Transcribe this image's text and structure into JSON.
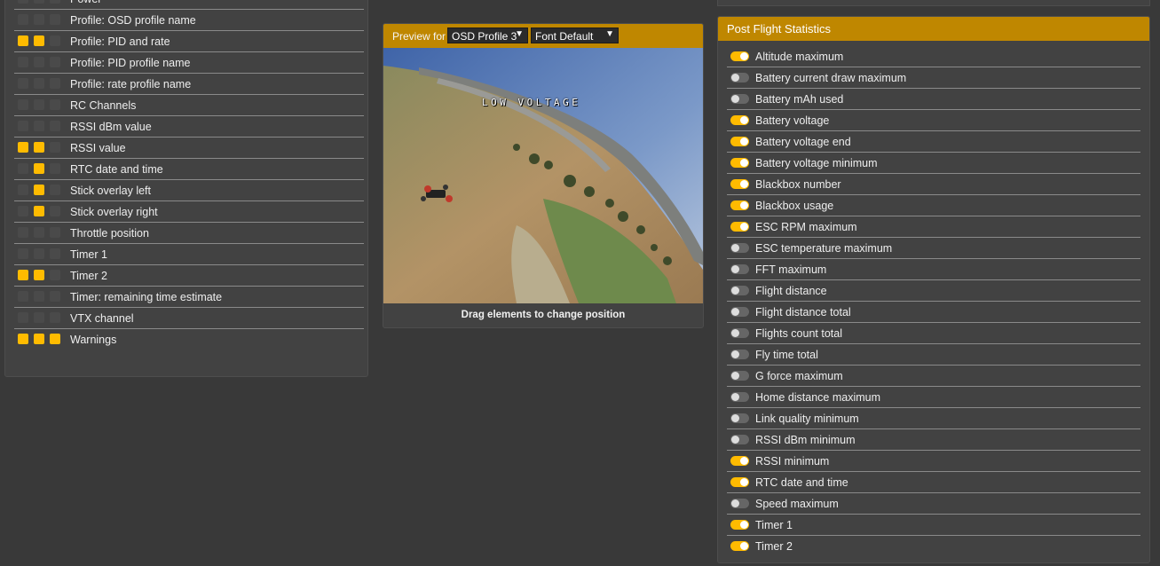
{
  "osd_elements": {
    "items": [
      {
        "label": "Power",
        "profiles": [
          false,
          false,
          false
        ]
      },
      {
        "label": "Profile: OSD profile name",
        "profiles": [
          false,
          false,
          false
        ]
      },
      {
        "label": "Profile: PID and rate",
        "profiles": [
          true,
          true,
          false
        ]
      },
      {
        "label": "Profile: PID profile name",
        "profiles": [
          false,
          false,
          false
        ]
      },
      {
        "label": "Profile: rate profile name",
        "profiles": [
          false,
          false,
          false
        ]
      },
      {
        "label": "RC Channels",
        "profiles": [
          false,
          false,
          false
        ]
      },
      {
        "label": "RSSI dBm value",
        "profiles": [
          false,
          false,
          false
        ]
      },
      {
        "label": "RSSI value",
        "profiles": [
          true,
          true,
          false
        ]
      },
      {
        "label": "RTC date and time",
        "profiles": [
          false,
          true,
          false
        ]
      },
      {
        "label": "Stick overlay left",
        "profiles": [
          false,
          true,
          false
        ]
      },
      {
        "label": "Stick overlay right",
        "profiles": [
          false,
          true,
          false
        ]
      },
      {
        "label": "Throttle position",
        "profiles": [
          false,
          false,
          false
        ]
      },
      {
        "label": "Timer 1",
        "profiles": [
          false,
          false,
          false
        ]
      },
      {
        "label": "Timer 2",
        "profiles": [
          true,
          true,
          false
        ]
      },
      {
        "label": "Timer: remaining time estimate",
        "profiles": [
          false,
          false,
          false
        ]
      },
      {
        "label": "VTX channel",
        "profiles": [
          false,
          false,
          false
        ]
      },
      {
        "label": "Warnings",
        "profiles": [
          true,
          true,
          true
        ]
      }
    ]
  },
  "preview": {
    "preview_for_label": "Preview for",
    "osd_profile_selected": "OSD Profile 3",
    "font_selected": "Font Default",
    "osd_warning_text": "LOW VOLTAGE",
    "drag_hint": "Drag elements to change position"
  },
  "post_flight": {
    "title": "Post Flight Statistics",
    "items": [
      {
        "label": "Altitude maximum",
        "enabled": true
      },
      {
        "label": "Battery current draw maximum",
        "enabled": false
      },
      {
        "label": "Battery mAh used",
        "enabled": false
      },
      {
        "label": "Battery voltage",
        "enabled": true
      },
      {
        "label": "Battery voltage end",
        "enabled": true
      },
      {
        "label": "Battery voltage minimum",
        "enabled": true
      },
      {
        "label": "Blackbox number",
        "enabled": true
      },
      {
        "label": "Blackbox usage",
        "enabled": true
      },
      {
        "label": "ESC RPM maximum",
        "enabled": true
      },
      {
        "label": "ESC temperature maximum",
        "enabled": false
      },
      {
        "label": "FFT maximum",
        "enabled": false
      },
      {
        "label": "Flight distance",
        "enabled": false
      },
      {
        "label": "Flight distance total",
        "enabled": false
      },
      {
        "label": "Flights count total",
        "enabled": false
      },
      {
        "label": "Fly time total",
        "enabled": false
      },
      {
        "label": "G force maximum",
        "enabled": false
      },
      {
        "label": "Home distance maximum",
        "enabled": false
      },
      {
        "label": "Link quality minimum",
        "enabled": false
      },
      {
        "label": "RSSI dBm minimum",
        "enabled": false
      },
      {
        "label": "RSSI minimum",
        "enabled": true
      },
      {
        "label": "RTC date and time",
        "enabled": true
      },
      {
        "label": "Speed maximum",
        "enabled": false
      },
      {
        "label": "Timer 1",
        "enabled": true
      },
      {
        "label": "Timer 2",
        "enabled": true
      }
    ]
  },
  "colors": {
    "accent": "#ffbb00",
    "header": "#bf8700",
    "panel": "#424242",
    "background": "#393939"
  }
}
